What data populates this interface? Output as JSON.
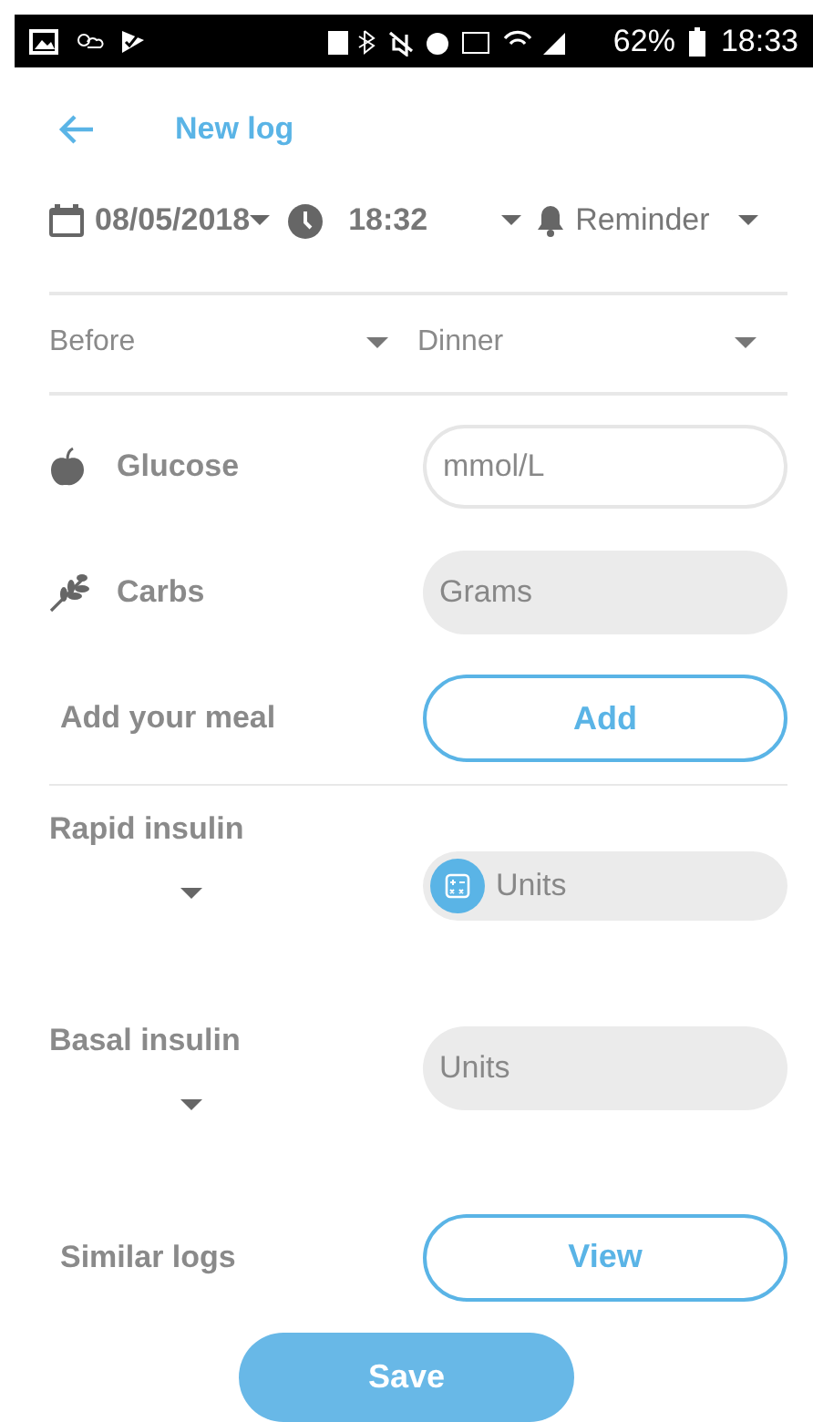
{
  "status_bar": {
    "battery": "62%",
    "time": "18:33"
  },
  "header": {
    "title": "New log"
  },
  "datetime": {
    "date": "08/05/2018",
    "time": "18:32",
    "reminder": "Reminder"
  },
  "meal_context": {
    "timing": "Before",
    "meal": "Dinner"
  },
  "measures": [
    {
      "label": "Glucose",
      "placeholder": "mmol/L",
      "focused": true
    },
    {
      "label": "Carbs",
      "placeholder": "Grams",
      "focused": false
    }
  ],
  "meal": {
    "label": "Add your meal",
    "button": "Add"
  },
  "insulins": [
    {
      "label": "Rapid insulin",
      "placeholder": "Units",
      "calculator": true
    },
    {
      "label": "Basal insulin",
      "placeholder": "Units",
      "calculator": false
    }
  ],
  "similar": {
    "label": "Similar logs",
    "button": "View"
  },
  "save_button": "Save"
}
